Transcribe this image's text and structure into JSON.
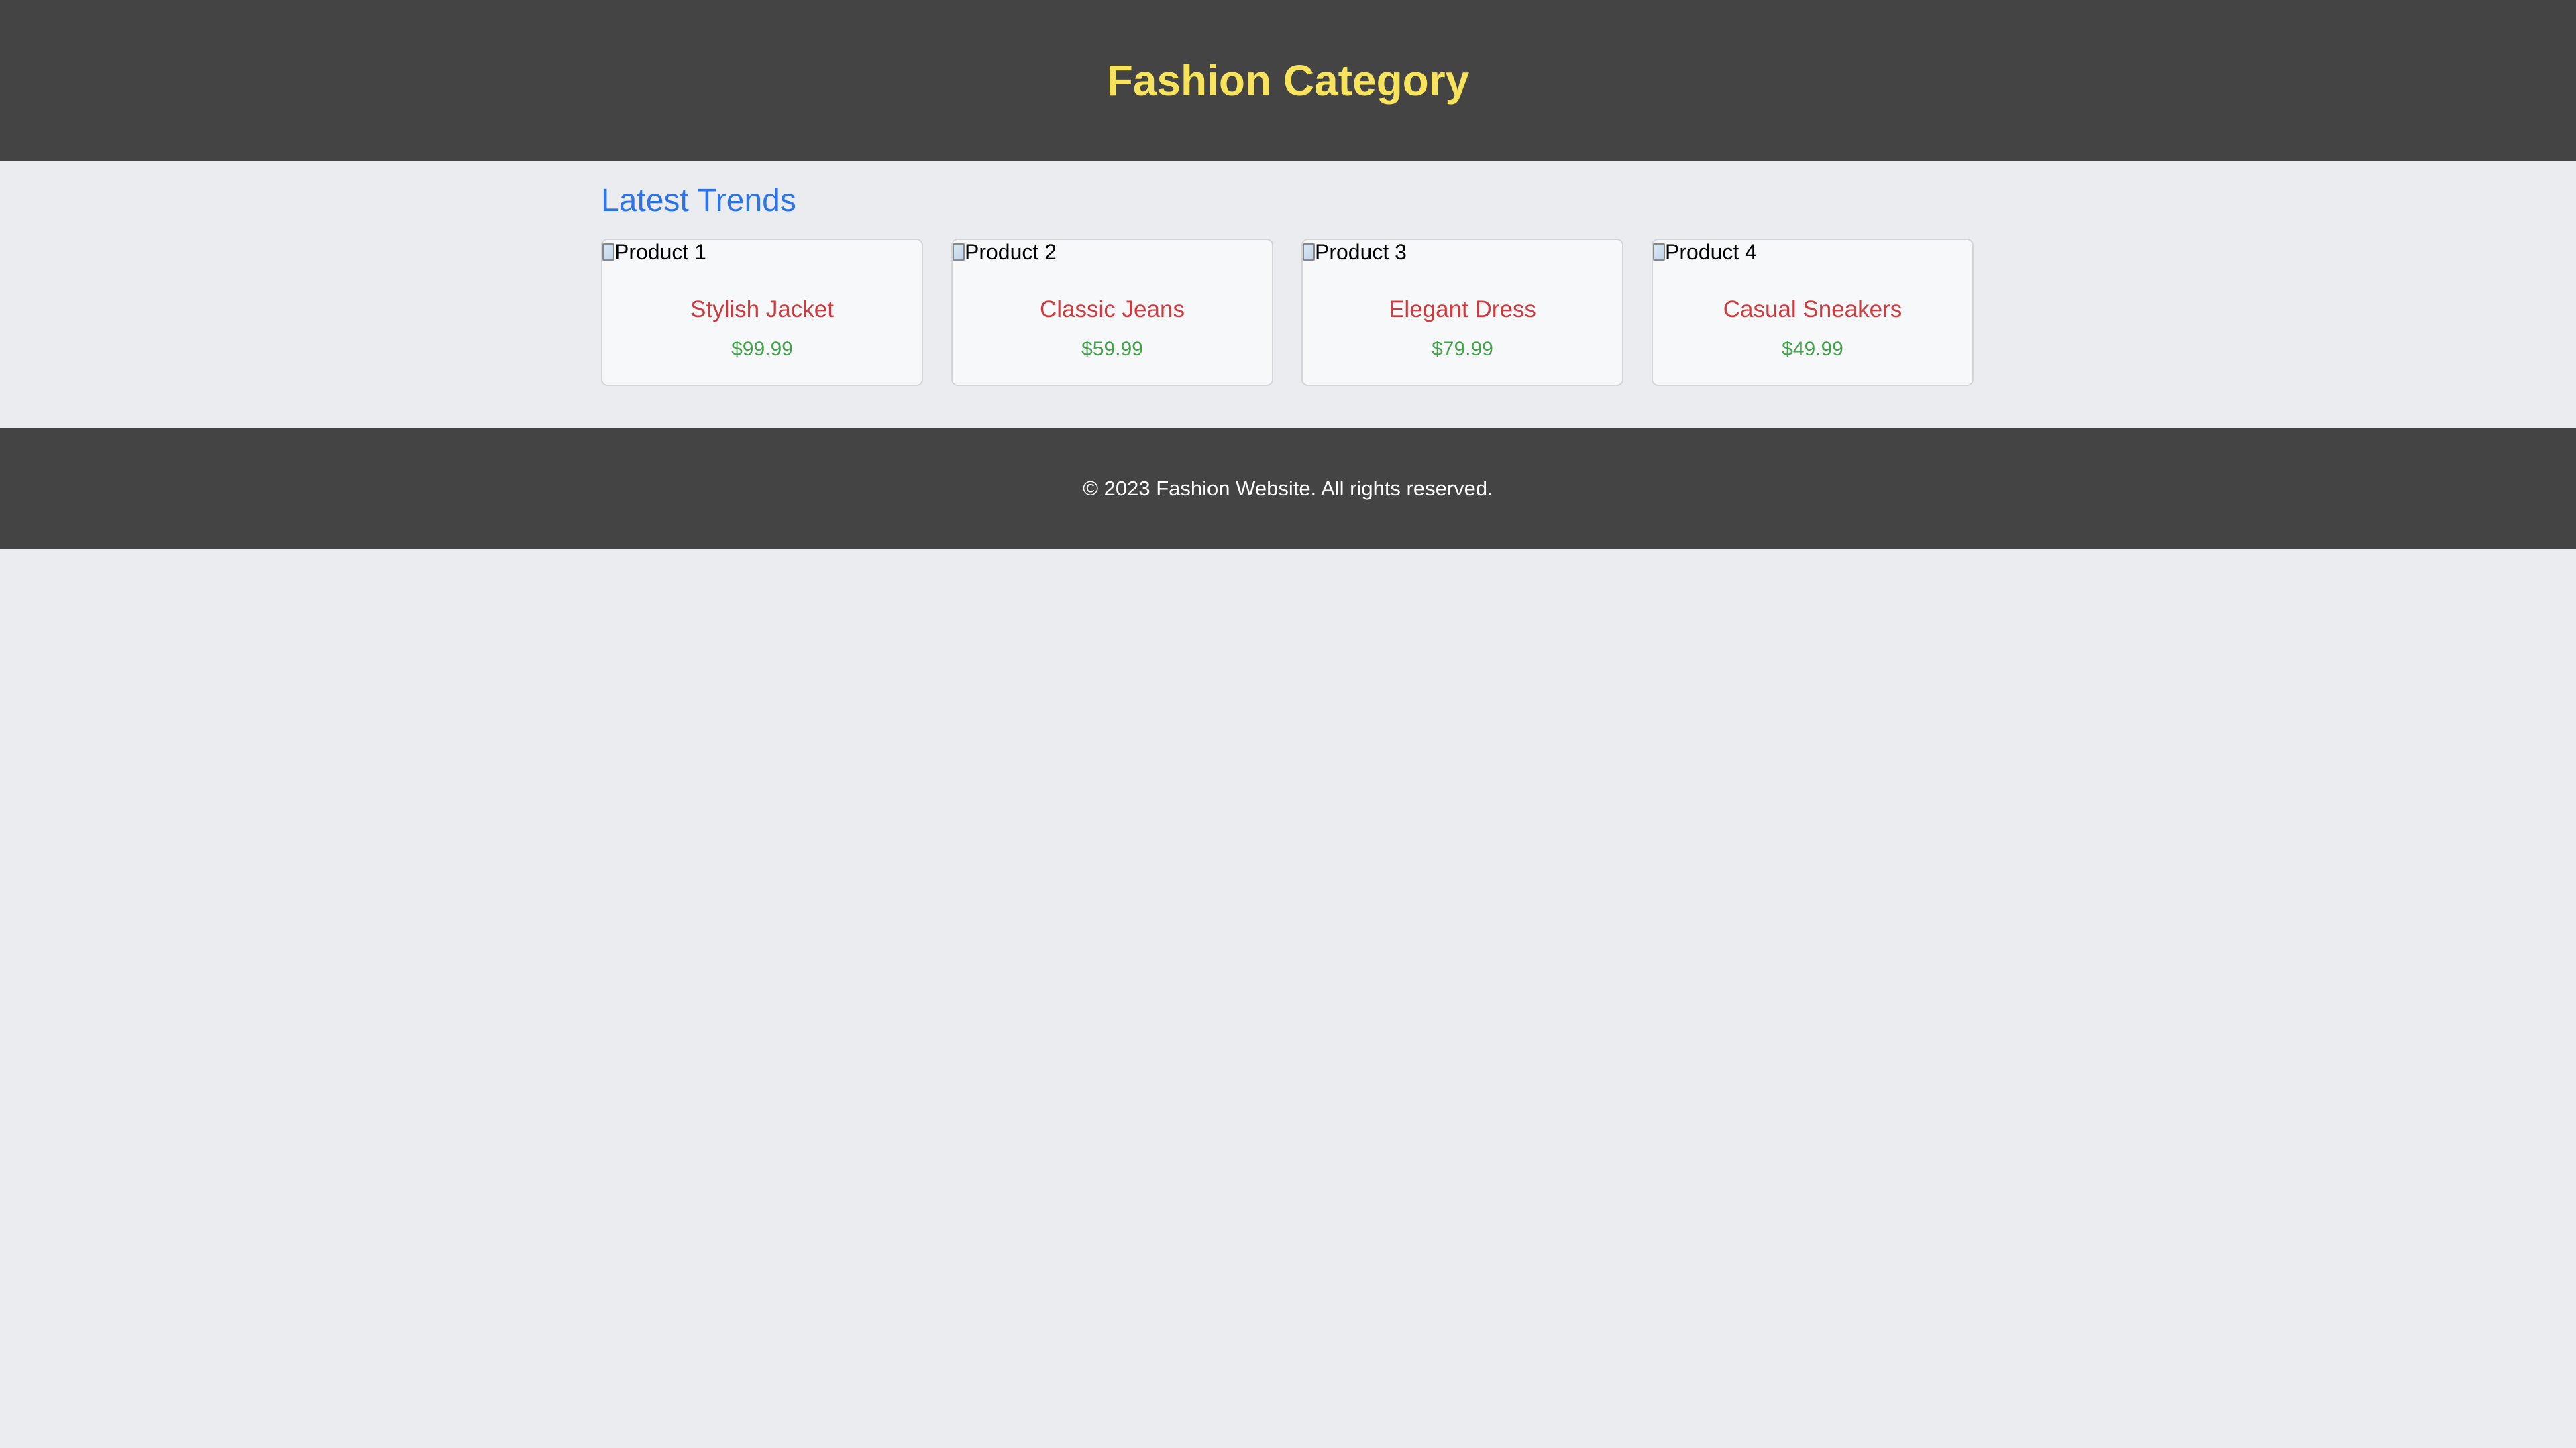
{
  "header": {
    "title": "Fashion Category"
  },
  "main": {
    "section_title": "Latest Trends",
    "products": [
      {
        "image_alt": "Product 1",
        "name": "Stylish Jacket",
        "price": "$99.99"
      },
      {
        "image_alt": "Product 2",
        "name": "Classic Jeans",
        "price": "$59.99"
      },
      {
        "image_alt": "Product 3",
        "name": "Elegant Dress",
        "price": "$79.99"
      },
      {
        "image_alt": "Product 4",
        "name": "Casual Sneakers",
        "price": "$49.99"
      }
    ]
  },
  "footer": {
    "text": "© 2023 Fashion Website. All rights reserved."
  },
  "colors": {
    "header_bg": "#444444",
    "title": "#f8e45c",
    "section_title": "#2d74e6",
    "product_name": "#cf3a3e",
    "product_price": "#42a149",
    "page_bg": "#eaecf0"
  },
  "icons": {
    "image_placeholder": "broken-image-icon"
  }
}
